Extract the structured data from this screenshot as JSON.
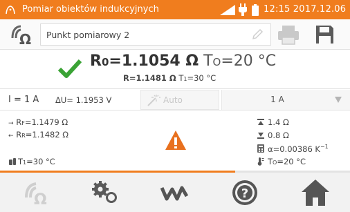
{
  "statusbar": {
    "title": "Pomiar obiektów indukcyjnych",
    "clock": "12:15 2017.12.06",
    "accent": "#f07d1e"
  },
  "point": {
    "label": "Punkt pomiarowy 2"
  },
  "result": {
    "main_symbol": "R",
    "main_subscript": "0",
    "main_value": "=1.1054 Ω",
    "temp_symbol": "T",
    "temp_subscript": "O",
    "temp_value": "=20 °C",
    "secondary_value": "R=1.1481 Ω",
    "secondary_temp_symbol": "T",
    "secondary_temp_subscript": "1",
    "secondary_temp_value": "=30 °C",
    "status_color": "#3aa335"
  },
  "params": {
    "current": "I = 1 A",
    "voltage_drop": "ΔU= 1.1953 V",
    "auto_label": "Auto",
    "range_selected": "1 A"
  },
  "details": {
    "rf_symbol": "R",
    "rf_subscript": "F",
    "rf_value": "=1.1479 Ω",
    "rr_symbol": "R",
    "rr_subscript": "R",
    "rr_value": "=1.1482 Ω",
    "t1_symbol": "T",
    "t1_subscript": "1",
    "t1_value": "=30 °C",
    "upper_limit": "1.4 Ω",
    "lower_limit": "0.8 Ω",
    "alpha": "α=0.00386 K",
    "alpha_exp": "−1",
    "to_symbol": "T",
    "to_subscript": "O",
    "to_value": "=20 °C",
    "warning_color": "#e8701e"
  },
  "nav": {
    "icons": [
      "ohm-meter-icon",
      "settings-icon",
      "waveform-icon",
      "help-icon",
      "home-icon"
    ]
  }
}
